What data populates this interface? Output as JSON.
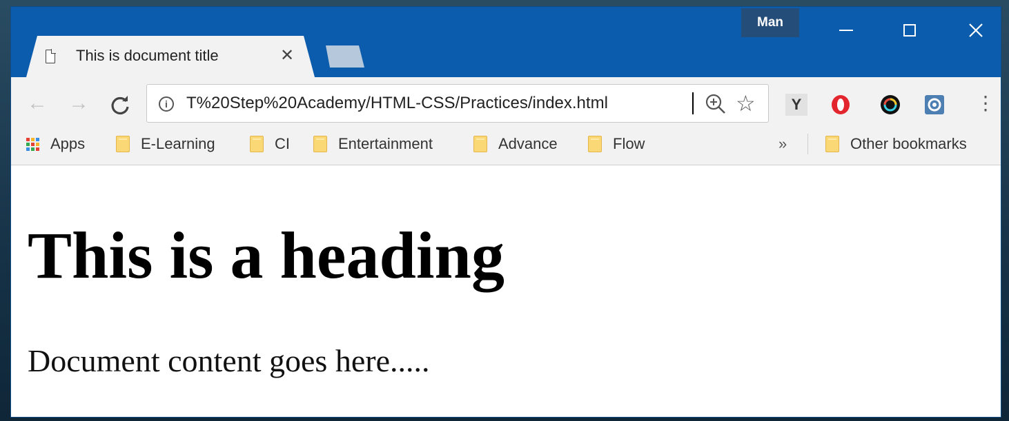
{
  "window": {
    "profile_name": "Man",
    "accent_color": "#0b5cad"
  },
  "tab": {
    "title": "This is document title",
    "close_glyph": "✕"
  },
  "toolbar": {
    "back_glyph": "←",
    "forward_glyph": "→",
    "reload_glyph": "C",
    "info_glyph": "i",
    "url": "T%20Step%20Academy/HTML-CSS/Practices/index.html",
    "star_glyph": "☆",
    "extension_y_label": "Y",
    "menu_glyph": "⋮"
  },
  "bookmarks": {
    "items": [
      {
        "label": "Apps",
        "icon": "apps-grid-icon"
      },
      {
        "label": "E-Learning",
        "icon": "folder-icon"
      },
      {
        "label": "CI",
        "icon": "folder-icon"
      },
      {
        "label": "Entertainment",
        "icon": "folder-icon"
      },
      {
        "label": "Advance",
        "icon": "folder-icon"
      },
      {
        "label": "Flow",
        "icon": "folder-icon"
      }
    ],
    "overflow_glyph": "»",
    "other_label": "Other bookmarks"
  },
  "page": {
    "heading": "This is a heading",
    "paragraph": "Document content goes here....."
  }
}
